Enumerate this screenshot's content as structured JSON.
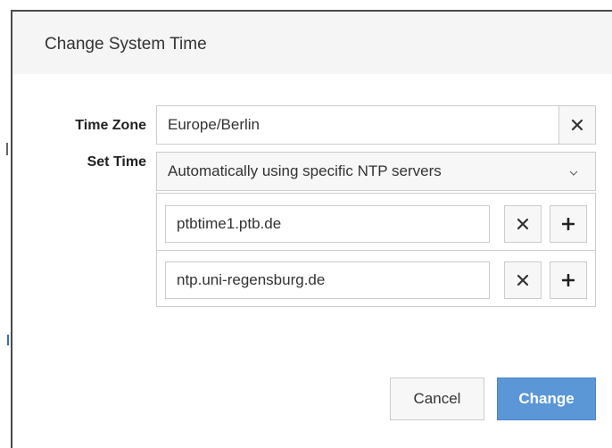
{
  "dialog": {
    "title": "Change System Time"
  },
  "time_zone": {
    "label": "Time Zone",
    "value": "Europe/Berlin",
    "clear_icon": "close-icon"
  },
  "set_time": {
    "label": "Set Time",
    "selected": "Automatically using specific NTP servers",
    "dropdown_icon": "chevron-down-icon"
  },
  "ntp_servers": [
    {
      "value": "ptbtime1.ptb.de",
      "remove_icon": "close-icon",
      "add_icon": "plus-icon"
    },
    {
      "value": "ntp.uni-regensburg.de",
      "remove_icon": "close-icon",
      "add_icon": "plus-icon"
    }
  ],
  "footer": {
    "cancel_label": "Cancel",
    "change_label": "Change"
  },
  "colors": {
    "primary": "#5b97d6",
    "header_bg": "#f5f5f5",
    "border": "#cccccc"
  }
}
